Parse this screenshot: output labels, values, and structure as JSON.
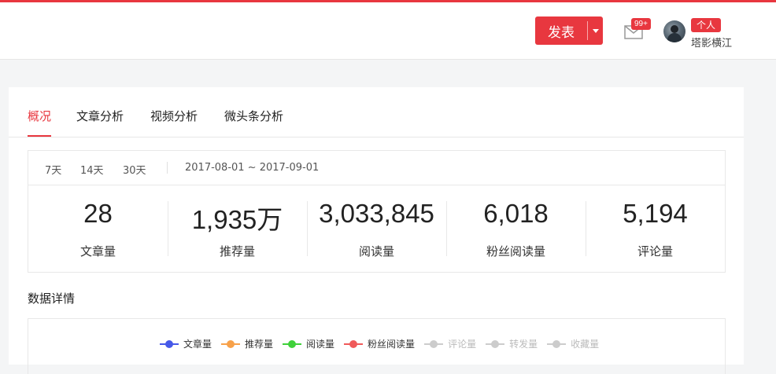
{
  "header": {
    "publish_label": "发表",
    "mail_badge": "99+",
    "account_tag": "个人",
    "username": "塔影横江",
    "accent_color": "#e8373f"
  },
  "tabs": [
    {
      "label": "概况",
      "active": true
    },
    {
      "label": "文章分析",
      "active": false
    },
    {
      "label": "视频分析",
      "active": false
    },
    {
      "label": "微头条分析",
      "active": false
    }
  ],
  "ranges": [
    "7天",
    "14天",
    "30天"
  ],
  "date_range": "2017-08-01 ~ 2017-09-01",
  "metrics": [
    {
      "value": "28",
      "label": "文章量"
    },
    {
      "value": "1,935万",
      "label": "推荐量"
    },
    {
      "value": "3,033,845",
      "label": "阅读量"
    },
    {
      "value": "6,018",
      "label": "粉丝阅读量"
    },
    {
      "value": "5,194",
      "label": "评论量"
    }
  ],
  "section_title": "数据详情",
  "legend": [
    {
      "label": "文章量",
      "color": "#4659e8",
      "active": true
    },
    {
      "label": "推荐量",
      "color": "#f7a14a",
      "active": true
    },
    {
      "label": "阅读量",
      "color": "#3fd13a",
      "active": true
    },
    {
      "label": "粉丝阅读量",
      "color": "#f05a5a",
      "active": true
    },
    {
      "label": "评论量",
      "color": "#cccccc",
      "active": false
    },
    {
      "label": "转发量",
      "color": "#cccccc",
      "active": false
    },
    {
      "label": "收藏量",
      "color": "#cccccc",
      "active": false
    }
  ]
}
